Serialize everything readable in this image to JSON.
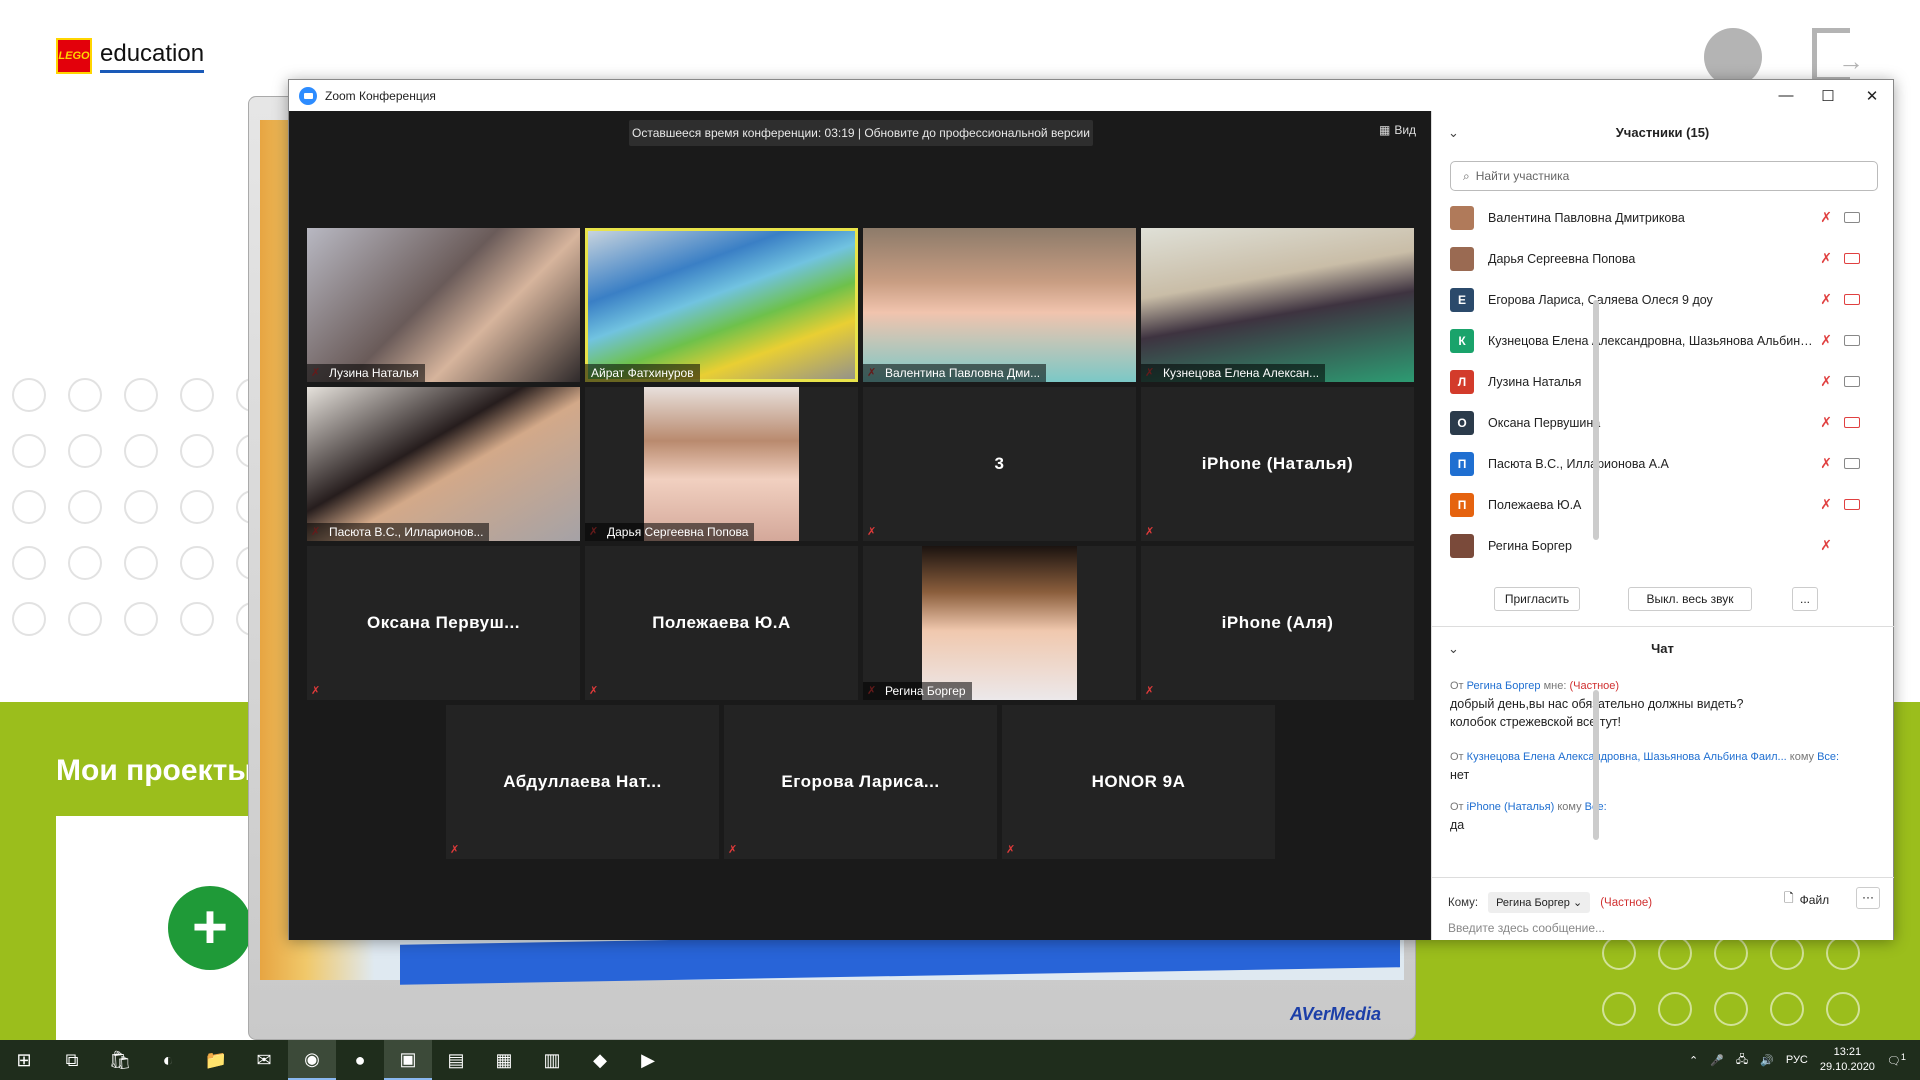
{
  "background_app": {
    "logo_box": "LEGO",
    "logo_text": "education",
    "section_title": "Мои проекты",
    "add_button": "+",
    "capture_brand": "AVerMedia"
  },
  "zoom": {
    "window_title": "Zoom Конференция",
    "banner": "Оставшееся время конференции: 03:19 | Обновите до профессиональной версии",
    "view_label": "Вид",
    "tiles": [
      {
        "name": "Лузина Наталья",
        "type": "video"
      },
      {
        "name": "Айрат Фатхинуров",
        "type": "video",
        "active": true
      },
      {
        "name": "Валентина Павловна Дми...",
        "type": "video"
      },
      {
        "name": "Кузнецова Елена Алексан...",
        "type": "video"
      },
      {
        "name": "Пасюта В.С., Илларионов...",
        "type": "video"
      },
      {
        "name": "Дарья Сергеевна Попова",
        "type": "video"
      },
      {
        "name": "3",
        "type": "name"
      },
      {
        "name": "iPhone (Наталья)",
        "type": "name"
      },
      {
        "name": "Оксана Первуш...",
        "type": "name"
      },
      {
        "name": "Полежаева Ю.А",
        "type": "name"
      },
      {
        "name": "Регина Боргер",
        "type": "video"
      },
      {
        "name": "iPhone (Аля)",
        "type": "name"
      },
      {
        "name": "Абдуллаева Нат...",
        "type": "name"
      },
      {
        "name": "Егорова Лариса...",
        "type": "name"
      },
      {
        "name": "HONOR 9A",
        "type": "name"
      }
    ],
    "participants": {
      "title": "Участники (15)",
      "search_placeholder": "Найти участника",
      "list": [
        {
          "name": "Валентина Павловна Дмитрикова",
          "initial": "",
          "color": "#b07a5a",
          "cam": "on"
        },
        {
          "name": "Дарья Сергеевна Попова",
          "initial": "",
          "color": "#9a6a52",
          "cam": "off"
        },
        {
          "name": "Егорова Лариса, Саляева Олеся 9 доу",
          "initial": "Е",
          "color": "#2b4a6b",
          "cam": "off"
        },
        {
          "name": "Кузнецова Елена Александровна, Шазьянова Альбина Фаиловна",
          "initial": "К",
          "color": "#1aa36b",
          "cam": "on"
        },
        {
          "name": "Лузина Наталья",
          "initial": "Л",
          "color": "#d33b2b",
          "cam": "on"
        },
        {
          "name": "Оксана Первушина",
          "initial": "О",
          "color": "#2b3b4b",
          "cam": "off"
        },
        {
          "name": "Пасюта В.С., Илларионова А.А",
          "initial": "П",
          "color": "#1f6fd1",
          "cam": "on"
        },
        {
          "name": "Полежаева Ю.А",
          "initial": "П",
          "color": "#e5630f",
          "cam": "off"
        },
        {
          "name": "Регина Боргер",
          "initial": "",
          "color": "#7a4a3a",
          "cam": "none"
        }
      ],
      "invite_label": "Пригласить",
      "mute_all_label": "Выкл. весь звук",
      "more_label": "..."
    },
    "chat": {
      "title": "Чат",
      "messages": [
        {
          "from_prefix": "От",
          "from": "Регина Боргер",
          "to_text": "мне:",
          "private": "(Частное)",
          "text": "добрый день,вы нас обязательно должны видеть?\nколобок стрежевской все тут!"
        },
        {
          "from_prefix": "От",
          "from": "Кузнецова Елена Александровна, Шазьянова Альбина Фаил...",
          "to_text": "кому",
          "to_target": "Все:",
          "text": "нет"
        },
        {
          "from_prefix": "От",
          "from": "iPhone (Наталья)",
          "to_text": "кому",
          "to_target": "Все:",
          "text": "да"
        }
      ],
      "to_label": "Кому:",
      "to_value": "Регина Боргер",
      "to_private": "(Частное)",
      "file_label": "Файл",
      "more_label": "···",
      "input_placeholder": "Введите здесь сообщение..."
    }
  },
  "taskbar": {
    "lang": "РУС",
    "time": "13:21",
    "date": "29.10.2020",
    "notif_count": "1"
  }
}
